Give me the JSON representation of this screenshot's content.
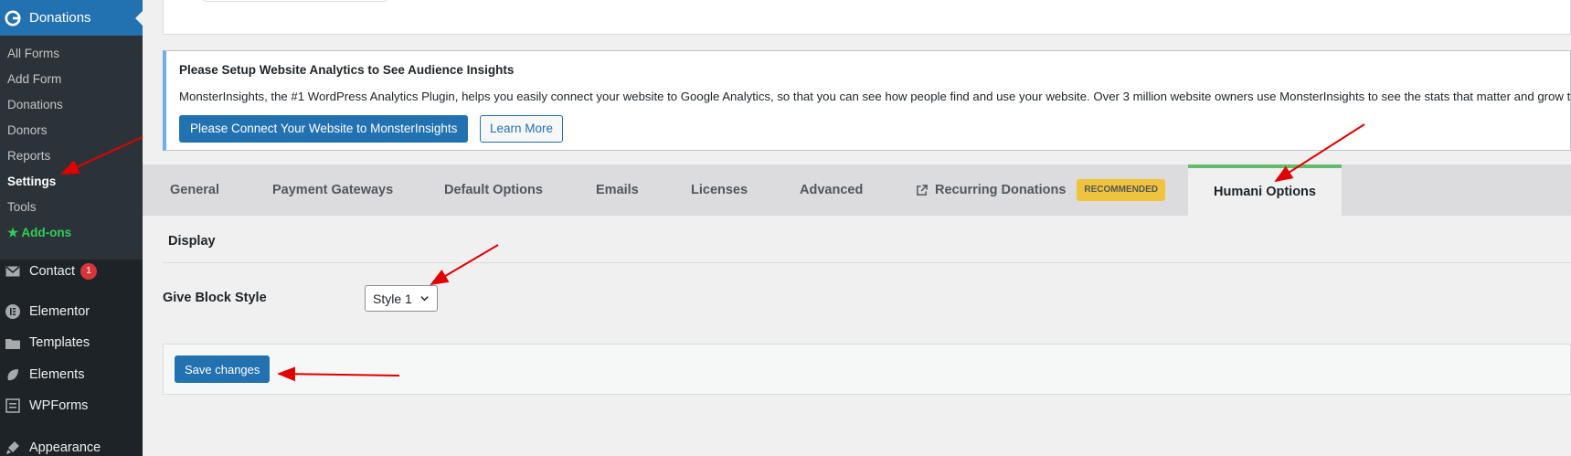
{
  "sidebar": {
    "active_menu": {
      "label": "Donations",
      "icon": "give-logo-icon"
    },
    "submenu": [
      {
        "label": "All Forms"
      },
      {
        "label": "Add Form"
      },
      {
        "label": "Donations"
      },
      {
        "label": "Donors"
      },
      {
        "label": "Reports"
      },
      {
        "label": "Settings"
      },
      {
        "label": "Tools"
      },
      {
        "label": "Add-ons"
      }
    ],
    "menu": [
      {
        "label": "Contact",
        "icon": "envelope-icon",
        "badge": "1"
      },
      {
        "label": "Elementor",
        "icon": "elementor-icon"
      },
      {
        "label": "Templates",
        "icon": "folder-icon"
      },
      {
        "label": "Elements",
        "icon": "leaf-icon"
      },
      {
        "label": "WPForms",
        "icon": "form-icon"
      },
      {
        "label": "Appearance",
        "icon": "brush-icon"
      }
    ]
  },
  "notice": {
    "title": "Please Setup Website Analytics to See Audience Insights",
    "body": "MonsterInsights, the #1 WordPress Analytics Plugin, helps you easily connect your website to Google Analytics, so that you can see how people find and use your website. Over 3 million website owners use MonsterInsights to see the stats that matter and grow their business.",
    "primary_button": "Please Connect Your Website to MonsterInsights",
    "secondary_button": "Learn More"
  },
  "tabs": [
    {
      "label": "General"
    },
    {
      "label": "Payment Gateways"
    },
    {
      "label": "Default Options"
    },
    {
      "label": "Emails"
    },
    {
      "label": "Licenses"
    },
    {
      "label": "Advanced"
    },
    {
      "label": "Recurring Donations",
      "badge": "RECOMMENDED"
    },
    {
      "label": "Humani Options",
      "active": true
    }
  ],
  "section": {
    "title": "Display"
  },
  "field": {
    "label": "Give Block Style",
    "value": "Style 1"
  },
  "save_button": "Save changes",
  "colors": {
    "sidebar_bg": "#1d2327",
    "submenu_bg": "#2c3338",
    "accent_blue": "#2271b1",
    "active_tab_border": "#66bb6a",
    "badge_yellow": "#f0c33c",
    "annotation_red": "#e00000"
  }
}
